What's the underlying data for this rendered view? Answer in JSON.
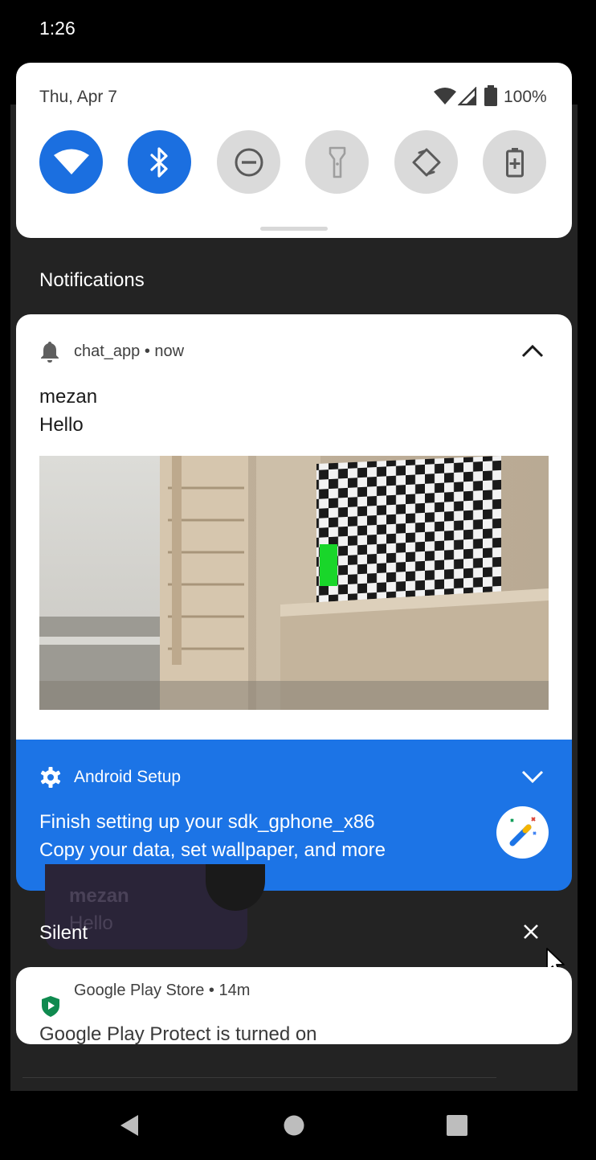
{
  "status_bar": {
    "time": "1:26"
  },
  "quick_settings": {
    "date": "Thu, Apr 7",
    "battery_percent": "100%",
    "tiles": [
      {
        "name": "wifi",
        "icon": "wifi-icon",
        "active": true
      },
      {
        "name": "bluetooth",
        "icon": "bluetooth-icon",
        "active": true
      },
      {
        "name": "do-not-disturb",
        "icon": "dnd-icon",
        "active": false
      },
      {
        "name": "flashlight",
        "icon": "flashlight-icon",
        "active": false
      },
      {
        "name": "auto-rotate",
        "icon": "rotate-icon",
        "active": false
      },
      {
        "name": "battery-saver",
        "icon": "battery-saver-icon",
        "active": false
      }
    ]
  },
  "notifications_header": "Notifications",
  "chat_notification": {
    "app": "chat_app",
    "time": "now",
    "title": "mezan",
    "text": "Hello"
  },
  "setup_notification": {
    "app": "Android Setup",
    "line1": "Finish setting up your sdk_gphone_x86",
    "line2": "Copy your data, set wallpaper, and more"
  },
  "ghost_card": {
    "title": "mezan",
    "text": "Hello"
  },
  "silent_header": "Silent",
  "play_notification": {
    "app": "Google Play Store",
    "time": "14m",
    "title": "Google Play Protect is turned on"
  },
  "colors": {
    "accent": "#1b6fe0",
    "setup_bg": "#1c74e6",
    "shade": "#232323",
    "play_protect": "#0f8a4f"
  }
}
